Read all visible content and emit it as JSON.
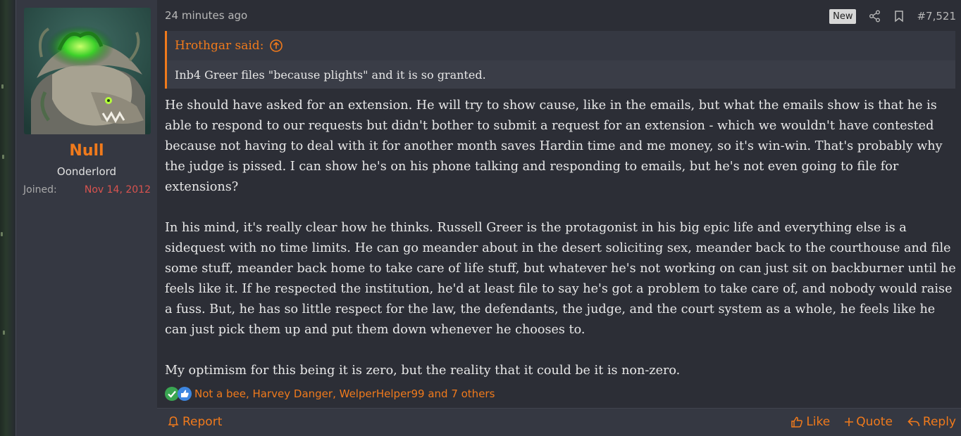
{
  "author": {
    "username": "Null",
    "title": "Oonderlord",
    "joined_label": "Joined:",
    "joined_date": "Nov 14, 2012"
  },
  "post": {
    "time": "24 minutes ago",
    "badge": "New",
    "number": "#7,521"
  },
  "quote": {
    "author_label": "Hrothgar said:",
    "text": "Inb4 Greer files \"because plights\" and it is so granted."
  },
  "body": {
    "paragraphs": [
      "He should have asked for an extension. He will try to show cause, like in the emails, but what the emails show is that he is able to respond to our requests but didn't bother to submit a request for an extension - which we wouldn't have contested because not having to deal with it for another month saves Hardin time and me money, so it's win-win. That's probably why the judge is pissed. I can show he's on his phone talking and responding to emails, but he's not even going to file for extensions?",
      "In his mind, it's really clear how he thinks. Russell Greer is the protagonist in his big epic life and everything else is a sidequest with no time limits. He can go meander about in the desert soliciting sex, meander back to the courthouse and file some stuff, meander back home to take care of life stuff, but whatever he's not working on can just sit on backburner until he feels like it. If he respected the institution, he'd at least file to say he's got a problem to take care of, and nobody would raise a fuss. But, he has so little respect for the law, the defendants, the judge, and the court system as a whole, he feels like he can just pick them up and put them down whenever he chooses to.",
      "My optimism for this being it is zero, but the reality that it could be it is non-zero."
    ]
  },
  "reactions": {
    "text": "Not a bee, Harvey Danger, WelperHelper99 and 7 others",
    "icons": [
      "check-icon",
      "thumbs-up-icon"
    ]
  },
  "footer": {
    "report": "Report",
    "like": "Like",
    "quote": "Quote",
    "reply": "Reply"
  },
  "colors": {
    "accent": "#f07a1c",
    "joined_date": "#d9534f",
    "background": "#2c2e36"
  }
}
